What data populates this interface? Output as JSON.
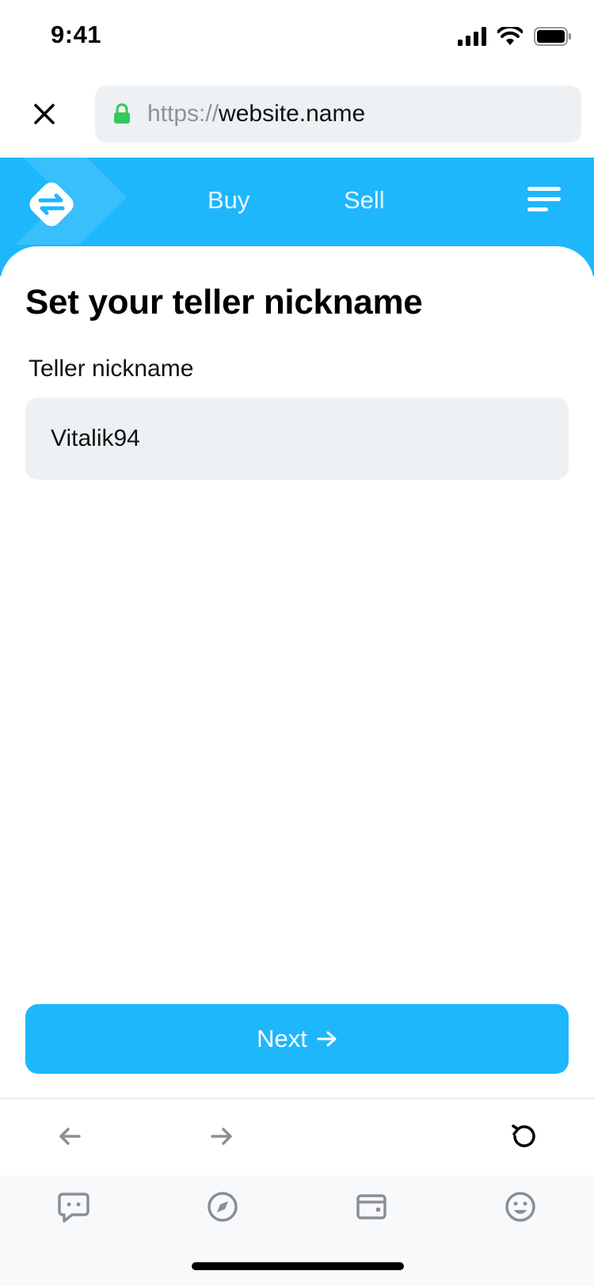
{
  "status": {
    "time": "9:41"
  },
  "browser": {
    "url_scheme": "https://",
    "url_host": "website.name"
  },
  "nav": {
    "buy": "Buy",
    "sell": "Sell"
  },
  "form": {
    "title": "Set your teller nickname",
    "label": "Teller nickname",
    "value": "Vitalik94",
    "button_label": "Next"
  },
  "colors": {
    "accent": "#1eb7fc",
    "field_bg": "#eef1f3",
    "lock": "#34c759"
  },
  "icons": {
    "back": "arrow-left-icon",
    "forward": "arrow-right-icon",
    "reload": "reload-icon",
    "tabs": [
      "chat-icon",
      "compass-icon",
      "wallet-icon",
      "smiley-icon"
    ]
  }
}
